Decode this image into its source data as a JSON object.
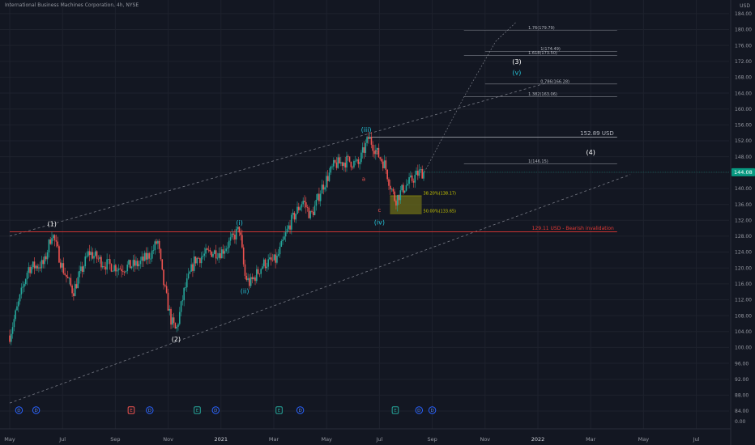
{
  "header": {
    "title": "International Business Machines Corporation, 4h, NYSE",
    "currency": "USD"
  },
  "colors": {
    "background": "#131722",
    "up": "#26a69a",
    "down": "#ef5350",
    "grid": "#1e222d",
    "axis_text": "#9598a1",
    "wave_white": "#ffffff",
    "wave_teal": "#26c6da",
    "wave_red": "#ef5350",
    "fib_yellow": "#c9c700",
    "zone": "#6b6b1a",
    "invalidation": "#e53935",
    "channel": "#787b86",
    "price_badge": "#089981"
  },
  "chart_data": {
    "type": "candlestick",
    "ylim": [
      84,
      186
    ],
    "y_ticks": [
      84,
      88,
      92,
      96,
      100,
      104,
      108,
      112,
      116,
      120,
      124,
      128,
      132,
      136,
      140,
      144,
      148,
      152,
      156,
      160,
      164,
      168,
      172,
      176,
      180,
      184
    ],
    "y_zero_tick": "0.00",
    "x_months": [
      "May",
      "Jul",
      "Sep",
      "Nov",
      "2021",
      "Mar",
      "May",
      "Jul",
      "Sep",
      "Nov",
      "2022",
      "Mar",
      "May",
      "Jul"
    ],
    "x_month_index": [
      0,
      2,
      4,
      6,
      8,
      10,
      12,
      14,
      16,
      18,
      20,
      22,
      24,
      26
    ],
    "x_start": "2020-05",
    "last_price": "144.08",
    "price_path": [
      {
        "t": 0,
        "p": 103
      },
      {
        "t": 0.7,
        "p": 120
      },
      {
        "t": 1.3,
        "p": 121
      },
      {
        "t": 1.6,
        "p": 129
      },
      {
        "t": 2.0,
        "p": 120
      },
      {
        "t": 2.4,
        "p": 114
      },
      {
        "t": 3.0,
        "p": 124
      },
      {
        "t": 3.6,
        "p": 121
      },
      {
        "t": 4.2,
        "p": 120
      },
      {
        "t": 4.9,
        "p": 121
      },
      {
        "t": 5.4,
        "p": 124
      },
      {
        "t": 5.6,
        "p": 127
      },
      {
        "t": 5.8,
        "p": 117
      },
      {
        "t": 6.1,
        "p": 107
      },
      {
        "t": 6.3,
        "p": 104
      },
      {
        "t": 6.6,
        "p": 114
      },
      {
        "t": 7.0,
        "p": 122
      },
      {
        "t": 7.6,
        "p": 124
      },
      {
        "t": 8.0,
        "p": 124
      },
      {
        "t": 8.4,
        "p": 127
      },
      {
        "t": 8.7,
        "p": 130
      },
      {
        "t": 8.9,
        "p": 118
      },
      {
        "t": 9.1,
        "p": 116
      },
      {
        "t": 9.6,
        "p": 121
      },
      {
        "t": 10.1,
        "p": 122
      },
      {
        "t": 10.6,
        "p": 131
      },
      {
        "t": 11.1,
        "p": 137
      },
      {
        "t": 11.4,
        "p": 133
      },
      {
        "t": 11.6,
        "p": 136
      },
      {
        "t": 11.8,
        "p": 140
      },
      {
        "t": 12.3,
        "p": 146
      },
      {
        "t": 12.8,
        "p": 147
      },
      {
        "t": 13.2,
        "p": 146
      },
      {
        "t": 13.6,
        "p": 152.9
      },
      {
        "t": 13.9,
        "p": 149
      },
      {
        "t": 14.2,
        "p": 146
      },
      {
        "t": 14.4,
        "p": 141
      },
      {
        "t": 14.6,
        "p": 137
      },
      {
        "t": 14.9,
        "p": 140
      },
      {
        "t": 15.2,
        "p": 142
      },
      {
        "t": 15.5,
        "p": 144
      },
      {
        "t": 15.7,
        "p": 144.08
      }
    ],
    "channel_upper": [
      {
        "t": 0,
        "p": 128
      },
      {
        "t": 20.3,
        "p": 166.5
      }
    ],
    "channel_lower": [
      {
        "t": 0,
        "p": 86
      },
      {
        "t": 23.5,
        "p": 143.5
      }
    ],
    "projection": [
      {
        "t": 15.7,
        "p": 144.08
      },
      {
        "t": 17.2,
        "p": 163
      },
      {
        "t": 18.4,
        "p": 177
      },
      {
        "t": 19.2,
        "p": 182
      }
    ],
    "levels": [
      {
        "label": "152.89 USD",
        "price": 152.89,
        "t0": 13.6,
        "t1": 23.0,
        "color": "#b2b5be"
      },
      {
        "label": "129.11 USD - Bearish invalidation",
        "price": 129.11,
        "t0": 0,
        "t1": 23.0,
        "color": "#e53935"
      }
    ],
    "fib_levels": [
      {
        "label": "1.76(179.79)",
        "price": 179.79,
        "t0": 17.2,
        "t1": 23.0
      },
      {
        "label": "1(174.49)",
        "price": 174.49,
        "t0": 18.0,
        "t1": 23.0
      },
      {
        "label": "1.618(173.50)",
        "price": 173.5,
        "t0": 17.2,
        "t1": 23.0
      },
      {
        "label": "0.786(166.28)",
        "price": 166.28,
        "t0": 18.0,
        "t1": 23.0
      },
      {
        "label": "1.382(163.06)",
        "price": 163.06,
        "t0": 17.2,
        "t1": 23.0
      },
      {
        "label": "1(146.15)",
        "price": 146.15,
        "t0": 17.2,
        "t1": 23.0
      },
      {
        "label": "38.20%(138.17)",
        "price": 138.17,
        "t0": 14.4,
        "t1": 15.6,
        "color": "#c9c700"
      },
      {
        "label": "50.00%(133.65)",
        "price": 133.65,
        "t0": 14.4,
        "t1": 15.6,
        "color": "#c9c700"
      }
    ],
    "zone": {
      "price_top": 138.17,
      "price_bottom": 133.65,
      "t0": 14.4,
      "t1": 15.6
    },
    "wave_labels": [
      {
        "label": "(1)",
        "t": 1.6,
        "p": 130.5,
        "color": "#ffffff"
      },
      {
        "label": "(2)",
        "t": 6.3,
        "p": 101.5,
        "color": "#ffffff"
      },
      {
        "label": "(3)",
        "t": 19.2,
        "p": 171.3,
        "color": "#ffffff"
      },
      {
        "label": "(4)",
        "t": 22.0,
        "p": 148.5,
        "color": "#ffffff"
      },
      {
        "label": "(i)",
        "t": 8.7,
        "p": 130.8,
        "color": "#26c6da"
      },
      {
        "label": "(ii)",
        "t": 8.9,
        "p": 113.6,
        "color": "#26c6da"
      },
      {
        "label": "(iii)",
        "t": 13.5,
        "p": 154.2,
        "color": "#26c6da"
      },
      {
        "label": "(iv)",
        "t": 14.0,
        "p": 130.9,
        "color": "#26c6da"
      },
      {
        "label": "(v)",
        "t": 19.2,
        "p": 168.6,
        "color": "#26c6da"
      },
      {
        "label": "a",
        "t": 13.4,
        "p": 141.9,
        "color": "#ef5350"
      },
      {
        "label": "b",
        "t": 13.9,
        "p": 148.6,
        "color": "#ef5350"
      },
      {
        "label": "c",
        "t": 14.0,
        "p": 134.1,
        "color": "#ef5350"
      }
    ],
    "event_markers": [
      {
        "t": 0.35,
        "kind": "D"
      },
      {
        "t": 1.0,
        "kind": "D"
      },
      {
        "t": 4.6,
        "kind": "E"
      },
      {
        "t": 5.3,
        "kind": "D"
      },
      {
        "t": 7.1,
        "kind": "E"
      },
      {
        "t": 7.8,
        "kind": "D"
      },
      {
        "t": 10.2,
        "kind": "E"
      },
      {
        "t": 11.0,
        "kind": "D"
      },
      {
        "t": 14.6,
        "kind": "E"
      },
      {
        "t": 15.5,
        "kind": "D"
      },
      {
        "t": 16.0,
        "kind": "D"
      }
    ]
  }
}
